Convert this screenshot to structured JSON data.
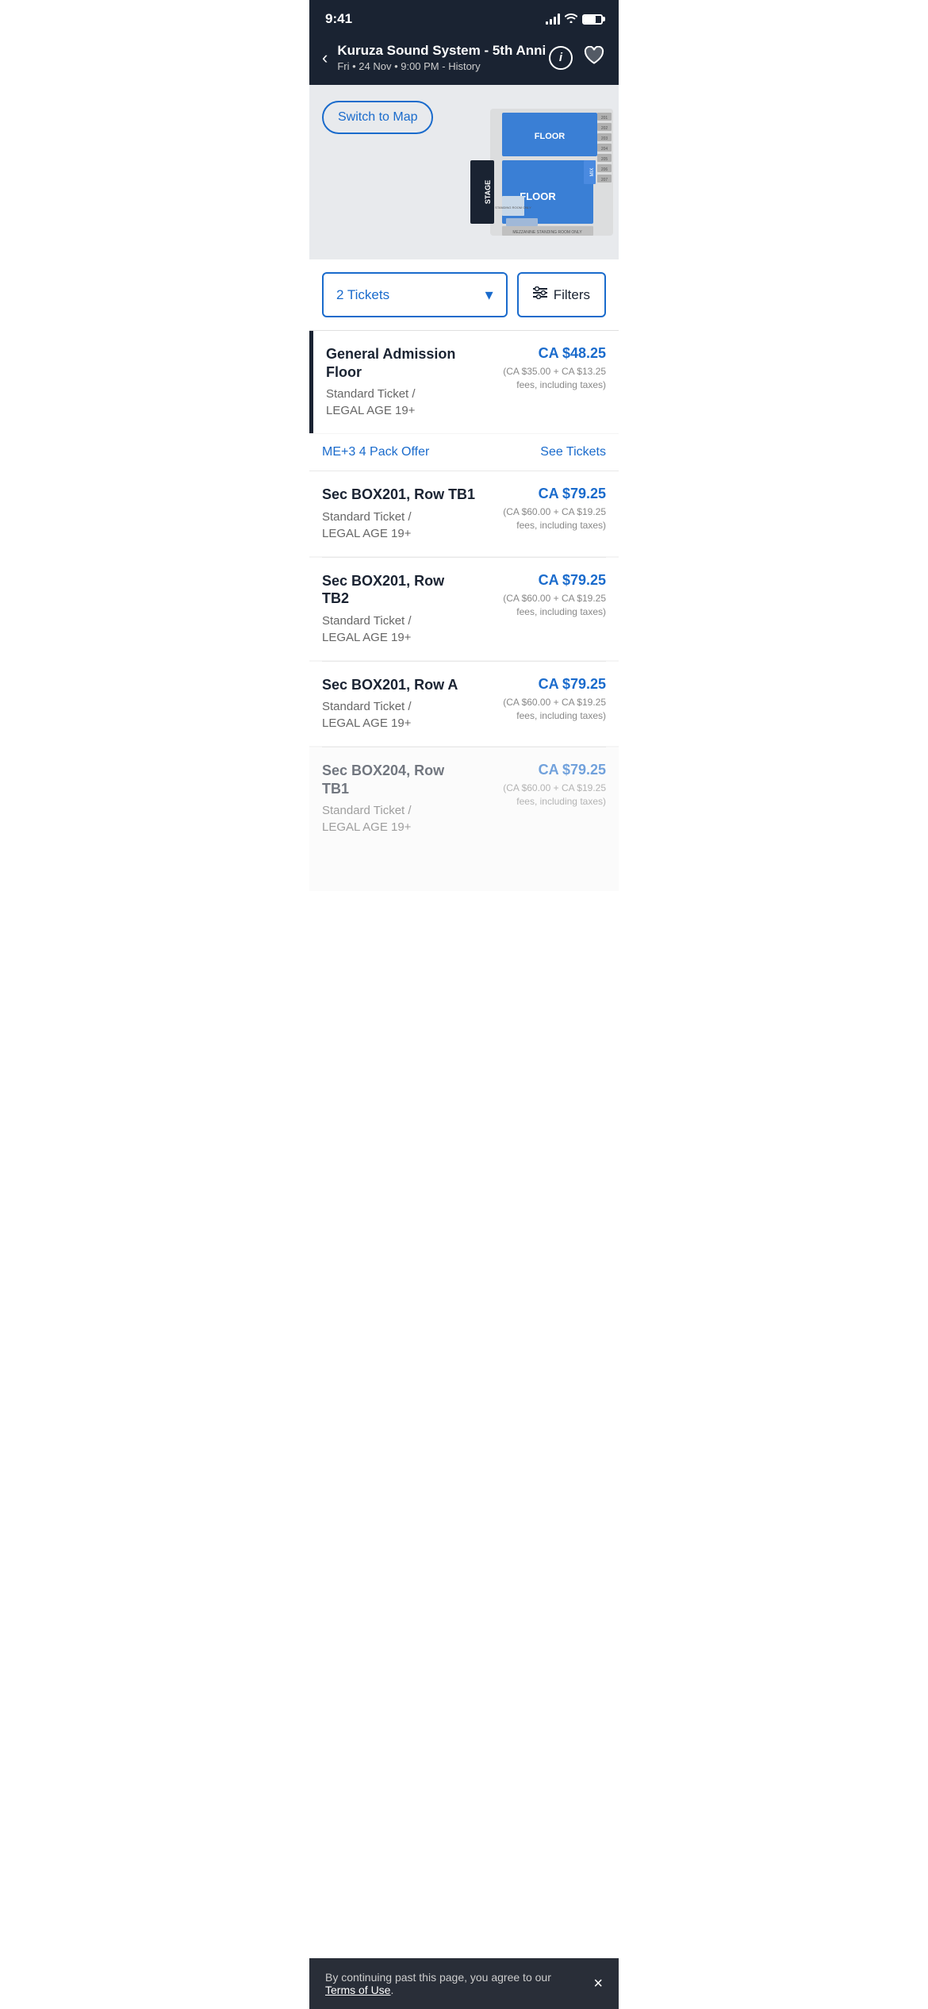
{
  "statusBar": {
    "time": "9:41"
  },
  "header": {
    "title": "Kuruza Sound System - 5th Anni",
    "subtitle": "Fri • 24 Nov • 9:00 PM - History",
    "backLabel": "‹",
    "infoLabel": "i"
  },
  "mapSection": {
    "switchToMapLabel": "Switch to Map"
  },
  "filters": {
    "ticketsLabel": "2 Tickets",
    "filtersLabel": "Filters"
  },
  "tickets": [
    {
      "section": "General Admission Floor",
      "details": "Standard Ticket / LEGAL AGE 19+",
      "price": "CA $48.25",
      "fee": "(CA $35.00 + CA $13.25 fees, including taxes)",
      "featured": true
    },
    {
      "section": "Sec BOX201, Row TB1",
      "details": "Standard Ticket / LEGAL AGE 19+",
      "price": "CA $79.25",
      "fee": "(CA $60.00 + CA $19.25 fees, including taxes)",
      "featured": false
    },
    {
      "section": "Sec BOX201, Row TB2",
      "details": "Standard Ticket / LEGAL AGE 19+",
      "price": "CA $79.25",
      "fee": "(CA $60.00 + CA $19.25 fees, including taxes)",
      "featured": false
    },
    {
      "section": "Sec BOX201, Row A",
      "details": "Standard Ticket / LEGAL AGE 19+",
      "price": "CA $79.25",
      "fee": "(CA $60.00 + CA $19.25 fees, including taxes)",
      "featured": false
    },
    {
      "section": "Sec BOX204, Row TB1",
      "details": "Standard Ticket / LEGAL AGE 19+",
      "price": "CA $79.25",
      "fee": "(CA $60.00 + CA $19.25 fees, including taxes)",
      "featured": false
    }
  ],
  "offerRow": {
    "label": "ME+3 4 Pack Offer",
    "seeTickets": "See Tickets"
  },
  "bottomBar": {
    "text": "By continuing past this page, you agree to our ",
    "linkText": "Terms of Use",
    "closeLabel": "×"
  }
}
